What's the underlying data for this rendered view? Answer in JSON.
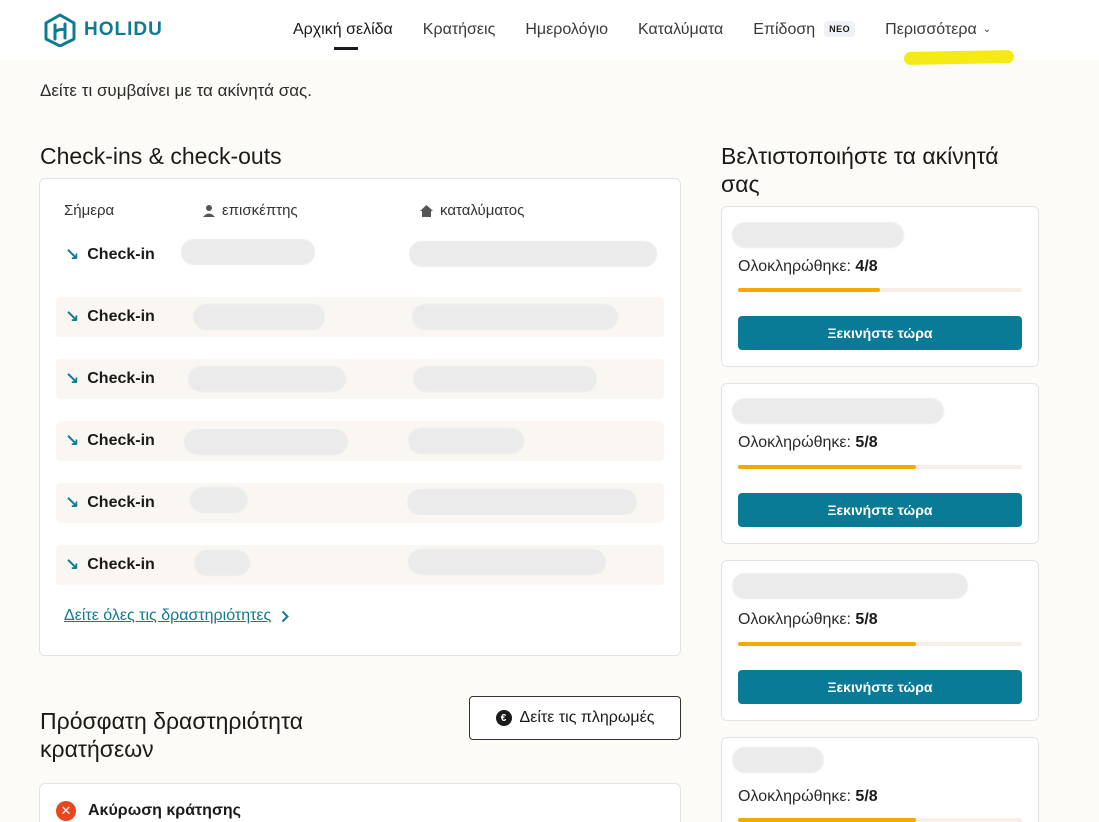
{
  "brand": {
    "name": "HOLIDU",
    "color": "#0e7b93"
  },
  "nav": {
    "items": [
      {
        "label": "Αρχική σελίδα"
      },
      {
        "label": "Κρατήσεις"
      },
      {
        "label": "Ημερολόγιο"
      },
      {
        "label": "Καταλύματα"
      },
      {
        "label": "Επίδοση"
      },
      {
        "label": "Περισσότερα"
      }
    ],
    "badge": "ΝΕΟ"
  },
  "subtitle": "Δείτε τι συμβαίνει με τα ακίνητά σας.",
  "checkins": {
    "title": "Check-ins & check-outs",
    "col_today": "Σήμερα",
    "col_guest": "επισκέπτης",
    "col_property": "καταλύματος",
    "rows": [
      {
        "label": "Check-in"
      },
      {
        "label": "Check-in"
      },
      {
        "label": "Check-in"
      },
      {
        "label": "Check-in"
      },
      {
        "label": "Check-in"
      },
      {
        "label": "Check-in"
      }
    ],
    "see_all": "Δείτε όλες τις δραστηριότητες"
  },
  "activity": {
    "title": "Πρόσφατη δραστηριότητα κρατήσεων",
    "payments_button": "Δείτε τις πληρωμές",
    "first_item": "Ακύρωση κράτησης"
  },
  "optimize": {
    "title": "Βελτιστοποιήστε τα ακίνητά σας",
    "progress_prefix": "Ολοκληρώθηκε:",
    "button": "Ξεκινήστε τώρα",
    "cards": [
      {
        "progress_text": "4/8",
        "progress": 0.5
      },
      {
        "progress_text": "5/8",
        "progress": 0.625
      },
      {
        "progress_text": "5/8",
        "progress": 0.625
      },
      {
        "progress_text": "5/8",
        "progress": 0.625
      }
    ]
  }
}
